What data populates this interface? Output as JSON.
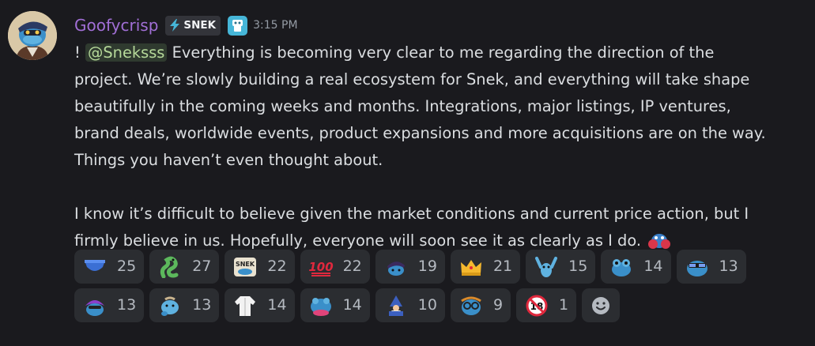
{
  "message": {
    "username": "Goofycrisp",
    "tag_label": "SNEK",
    "timestamp": "3:15 PM",
    "prefix": "!",
    "mention": "@Sneksss",
    "paragraph1_lines": [
      " Everything is becoming very clear to me regarding the direction of the",
      "project. We’re slowly building a real ecosystem for Snek, and everything will take shape",
      "beautifully in the coming weeks and months. Integrations, major listings, IP ventures,",
      "brand deals, worldwide events, product expansions and more acquisitions are on the way.",
      "Things you haven’t even thought about."
    ],
    "paragraph2_lines": [
      "I know it’s difficult to believe given the market conditions and current price action, but I",
      "firmly believe in us. Hopefully, everyone will soon see it as clearly as I do."
    ],
    "inline_emoji": "snek-boxing-emoji"
  },
  "reactions": {
    "row1": [
      {
        "icon": "blue-briefs-emoji",
        "count": "25"
      },
      {
        "icon": "green-snake-emoji",
        "count": "27"
      },
      {
        "icon": "snek-logo-emoji",
        "count": "22"
      },
      {
        "icon": "hundred-points-emoji",
        "count": "22"
      },
      {
        "icon": "snek-hat-emoji",
        "count": "19"
      },
      {
        "icon": "crown-emoji",
        "count": "21"
      },
      {
        "icon": "snek-arms-up-emoji",
        "count": "15"
      },
      {
        "icon": "snek-frog-emoji",
        "count": "14"
      },
      {
        "icon": "snek-sunglasses-emoji",
        "count": "13"
      }
    ],
    "row2": [
      {
        "icon": "snek-purple-hair-emoji",
        "count": "13"
      },
      {
        "icon": "snek-thinking-emoji",
        "count": "13"
      },
      {
        "icon": "lab-coat-emoji",
        "count": "14"
      },
      {
        "icon": "snek-pink-frog-emoji",
        "count": "14"
      },
      {
        "icon": "wizard-emoji",
        "count": "10"
      },
      {
        "icon": "snek-glasses-emoji",
        "count": "9"
      },
      {
        "icon": "no-one-under-eighteen-emoji",
        "count": "1"
      }
    ],
    "add_reaction_icon": "add-reaction-smiley-icon"
  },
  "colors": {
    "background": "#1a1a1e",
    "username": "#a16fd6",
    "text": "#dbdee1",
    "reaction_bg": "#2b2d31",
    "mention_bg": "#2f3a2f",
    "mention_text": "#b6d99a"
  }
}
